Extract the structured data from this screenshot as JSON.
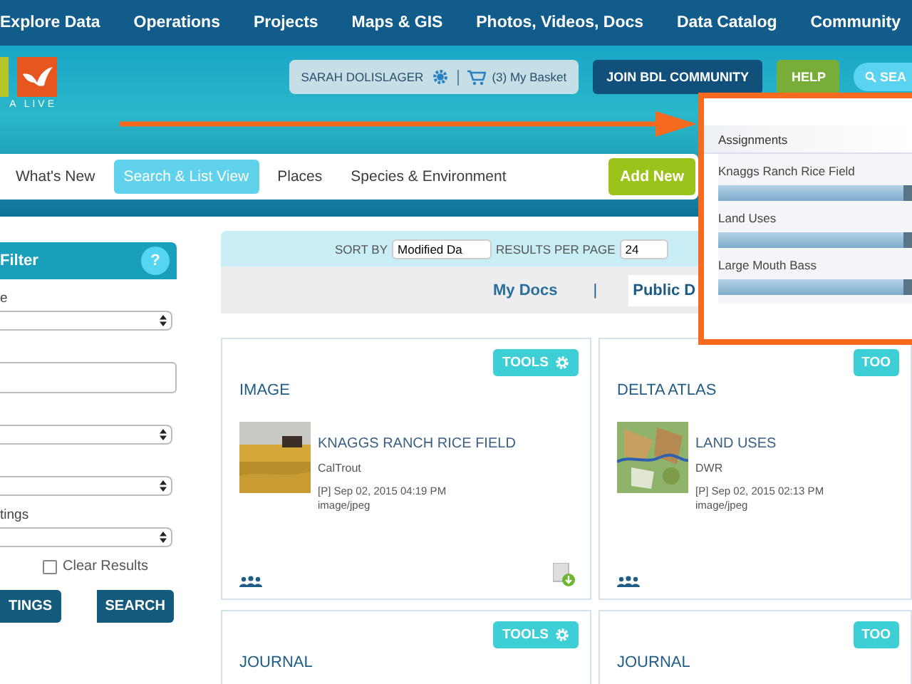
{
  "top_nav": [
    "Explore Data",
    "Operations",
    "Projects",
    "Maps & GIS",
    "Photos, Videos, Docs",
    "Data Catalog",
    "Community"
  ],
  "header": {
    "logo_text": "A LIVE",
    "user": "SARAH DOLISLAGER",
    "basket": "(3) My Basket",
    "join": "JOIN BDL COMMUNITY",
    "help": "HELP",
    "search": "SEA"
  },
  "sub_nav": {
    "items": [
      {
        "label": "What's New",
        "selected": false
      },
      {
        "label": "Search & List View",
        "selected": true
      },
      {
        "label": "Places",
        "selected": false
      },
      {
        "label": "Species & Environment",
        "selected": false
      }
    ],
    "add_new": "Add New"
  },
  "filter": {
    "title": "Filter",
    "help": "?",
    "fields": [
      {
        "kind": "select",
        "label": "e"
      },
      {
        "kind": "input"
      },
      {
        "kind": "select"
      },
      {
        "kind": "select"
      },
      {
        "kind": "select",
        "label": "tings"
      }
    ],
    "clear_results": {
      "label": "Clear Results",
      "checked": false
    },
    "buttons": [
      "TINGS",
      "SEARCH"
    ]
  },
  "sort": {
    "sort_by_label": "SORT BY",
    "sort_value": "Modified Da",
    "per_page_label": "RESULTS PER PAGE",
    "per_page_value": "24"
  },
  "doc_tabs": {
    "items": [
      {
        "label": "My Docs",
        "selected": false
      },
      {
        "label": "Public D",
        "selected": true
      }
    ],
    "separator": "|"
  },
  "cards": [
    {
      "tools": "TOOLS",
      "category": "IMAGE",
      "title": "KNAGGS RANCH RICE FIELD",
      "org": "CalTrout",
      "date": "[P] Sep 02, 2015 04:19 PM",
      "mime": "image/jpeg",
      "download": true
    },
    {
      "tools": "TOO",
      "category": "DELTA ATLAS",
      "title": "LAND USES",
      "org": "DWR",
      "date": "[P] Sep 02, 2015 02:13 PM",
      "mime": "image/jpeg",
      "download": false
    },
    {
      "tools": "TOOLS",
      "category": "JOURNAL"
    },
    {
      "tools": "TOO",
      "category": "JOURNAL"
    }
  ],
  "assignments": {
    "title": "Assignments",
    "items": [
      {
        "label": "Knaggs Ranch Rice Field"
      },
      {
        "label": "Land Uses"
      },
      {
        "label": "Large Mouth Bass"
      }
    ]
  }
}
